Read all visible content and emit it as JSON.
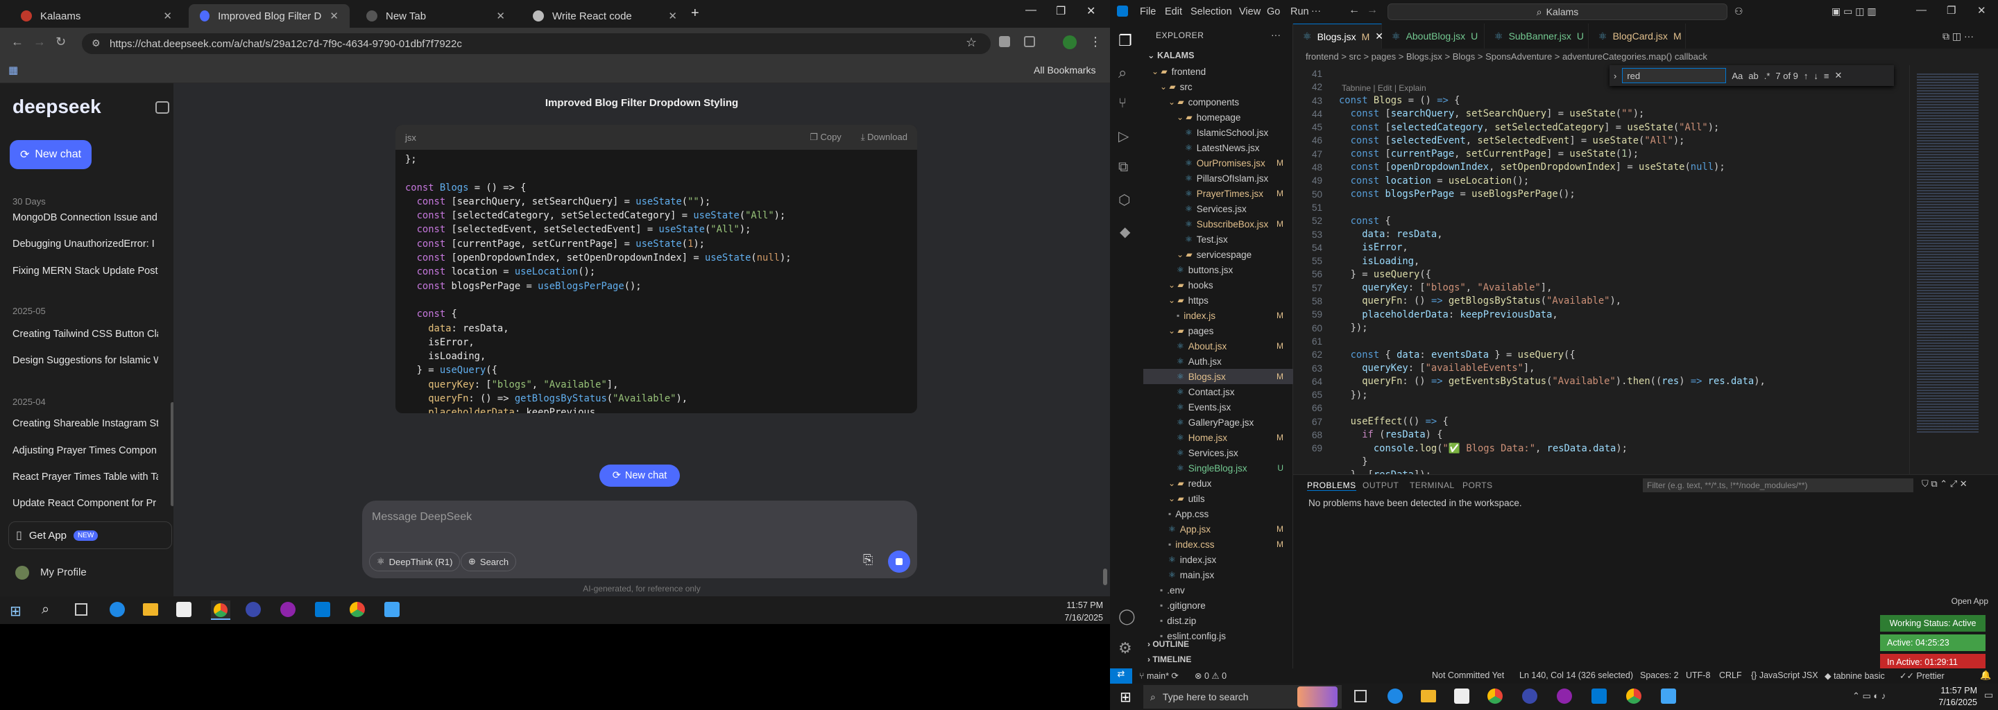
{
  "chrome": {
    "tabs": [
      {
        "label": "Kalaams"
      },
      {
        "label": "Improved Blog Filter Dropdown"
      },
      {
        "label": "New Tab"
      },
      {
        "label": "Write React code"
      }
    ],
    "url": "https://chat.deepseek.com/a/chat/s/29a12c7d-7f9c-4634-9790-01dbf7f7922c",
    "all_bookmarks": "All Bookmarks"
  },
  "deepseek": {
    "logo": "deepseek",
    "new_chat": "New chat",
    "history": [
      {
        "section": "30 Days",
        "items": [
          "MongoDB Connection Issue and",
          "Debugging UnauthorizedError: I",
          "Fixing MERN Stack Update Post I"
        ]
      },
      {
        "section": "2025-05",
        "items": [
          "Creating Tailwind CSS Button Cla",
          "Design Suggestions for Islamic W"
        ]
      },
      {
        "section": "2025-04",
        "items": [
          "Creating Shareable Instagram St",
          "Adjusting Prayer Times Compon",
          "React Prayer Times Table with Ta",
          "Update React Component for Pr"
        ]
      }
    ],
    "get_app": "Get App",
    "new_badge": "NEW",
    "profile": "My Profile",
    "chat_title": "Improved Blog Filter Dropdown Styling",
    "code_lang": "jsx",
    "copy": "Copy",
    "download": "Download",
    "new_chat_btn": "New chat",
    "input_placeholder": "Message DeepSeek",
    "deepthink": "DeepThink (R1)",
    "search": "Search",
    "disclaimer": "AI-generated, for reference only"
  },
  "taskbar_left": {
    "time": "11:57 PM",
    "date": "7/16/2025"
  },
  "vscode": {
    "menu": [
      "File",
      "Edit",
      "Selection",
      "View",
      "Go",
      "Run"
    ],
    "search": "Kalams",
    "explorer": "EXPLORER",
    "root": "KALAMS",
    "tabs": [
      {
        "label": "Blogs.jsx",
        "badge": "M"
      },
      {
        "label": "AboutBlog.jsx",
        "badge": "U"
      },
      {
        "label": "SubBanner.jsx",
        "badge": "U"
      },
      {
        "label": "BlogCard.jsx",
        "badge": "M"
      }
    ],
    "breadcrumb": "frontend > src > pages > Blogs.jsx > Blogs > SponsAdventure > adventureCategories.map() callback",
    "find": {
      "value": "red",
      "count": "7 of 9"
    },
    "tabnine": "Tabnine | Edit | Explain",
    "tree": [
      {
        "name": "frontend",
        "depth": 1,
        "type": "folder",
        "badge": ""
      },
      {
        "name": "src",
        "depth": 2,
        "type": "folder",
        "badge": ""
      },
      {
        "name": "components",
        "depth": 3,
        "type": "folder",
        "badge": ""
      },
      {
        "name": "homepage",
        "depth": 4,
        "type": "folder",
        "badge": ""
      },
      {
        "name": "IslamicSchool.jsx",
        "depth": 5,
        "type": "file",
        "badge": ""
      },
      {
        "name": "LatestNews.jsx",
        "depth": 5,
        "type": "file",
        "badge": ""
      },
      {
        "name": "OurPromises.jsx",
        "depth": 5,
        "type": "file",
        "badge": "M"
      },
      {
        "name": "PillarsOfIslam.jsx",
        "depth": 5,
        "type": "file",
        "badge": ""
      },
      {
        "name": "PrayerTimes.jsx",
        "depth": 5,
        "type": "file",
        "badge": "M"
      },
      {
        "name": "Services.jsx",
        "depth": 5,
        "type": "file",
        "badge": ""
      },
      {
        "name": "SubscribeBox.jsx",
        "depth": 5,
        "type": "file",
        "badge": "M"
      },
      {
        "name": "Test.jsx",
        "depth": 5,
        "type": "file",
        "badge": ""
      },
      {
        "name": "servicespage",
        "depth": 4,
        "type": "folder",
        "badge": ""
      },
      {
        "name": "buttons.jsx",
        "depth": 4,
        "type": "file",
        "badge": ""
      },
      {
        "name": "hooks",
        "depth": 3,
        "type": "folder",
        "badge": ""
      },
      {
        "name": "https",
        "depth": 3,
        "type": "folder",
        "badge": ""
      },
      {
        "name": "index.js",
        "depth": 4,
        "type": "file",
        "badge": "M"
      },
      {
        "name": "pages",
        "depth": 3,
        "type": "folder",
        "badge": ""
      },
      {
        "name": "About.jsx",
        "depth": 4,
        "type": "file",
        "badge": "M"
      },
      {
        "name": "Auth.jsx",
        "depth": 4,
        "type": "file",
        "badge": ""
      },
      {
        "name": "Blogs.jsx",
        "depth": 4,
        "type": "file",
        "badge": "M"
      },
      {
        "name": "Contact.jsx",
        "depth": 4,
        "type": "file",
        "badge": ""
      },
      {
        "name": "Events.jsx",
        "depth": 4,
        "type": "file",
        "badge": ""
      },
      {
        "name": "GalleryPage.jsx",
        "depth": 4,
        "type": "file",
        "badge": ""
      },
      {
        "name": "Home.jsx",
        "depth": 4,
        "type": "file",
        "badge": "M"
      },
      {
        "name": "Services.jsx",
        "depth": 4,
        "type": "file",
        "badge": ""
      },
      {
        "name": "SingleBlog.jsx",
        "depth": 4,
        "type": "file",
        "badge": "U"
      },
      {
        "name": "redux",
        "depth": 3,
        "type": "folder",
        "badge": ""
      },
      {
        "name": "utils",
        "depth": 3,
        "type": "folder",
        "badge": ""
      },
      {
        "name": "App.css",
        "depth": 3,
        "type": "file",
        "badge": ""
      },
      {
        "name": "App.jsx",
        "depth": 3,
        "type": "file",
        "badge": "M"
      },
      {
        "name": "index.css",
        "depth": 3,
        "type": "file",
        "badge": "M"
      },
      {
        "name": "index.jsx",
        "depth": 3,
        "type": "file",
        "badge": ""
      },
      {
        "name": "main.jsx",
        "depth": 3,
        "type": "file",
        "badge": ""
      },
      {
        "name": ".env",
        "depth": 2,
        "type": "file",
        "badge": ""
      },
      {
        "name": ".gitignore",
        "depth": 2,
        "type": "file",
        "badge": ""
      },
      {
        "name": "dist.zip",
        "depth": 2,
        "type": "file",
        "badge": ""
      },
      {
        "name": "eslint.config.js",
        "depth": 2,
        "type": "file",
        "badge": ""
      }
    ],
    "outline": "OUTLINE",
    "timeline": "TIMELINE",
    "line_numbers": [
      "41",
      "42",
      "43",
      "44",
      "45",
      "46",
      "47",
      "48",
      "49",
      "50",
      "51",
      "52",
      "53",
      "54",
      "55",
      "56",
      "57",
      "58",
      "59",
      "60",
      "61",
      "62",
      "63",
      "64",
      "65",
      "66",
      "67",
      "68",
      "69"
    ],
    "panel": {
      "tabs": [
        "PROBLEMS",
        "OUTPUT",
        "TERMINAL",
        "PORTS"
      ],
      "filter": "Filter (e.g. text, **/*.ts, !**/node_modules/**)",
      "message": "No problems have been detected in the workspace."
    },
    "status": {
      "branch": "main*",
      "errors": "0",
      "warnings": "0",
      "commit": "Not Committed Yet",
      "position": "Ln 140, Col 14 (326 selected)",
      "spaces": "Spaces: 2",
      "encoding": "UTF-8",
      "eol": "CRLF",
      "lang": "JavaScript JSX",
      "tabnine": "tabnine basic",
      "prettier": "Prettier"
    },
    "widgets": {
      "open_app": "Open App",
      "working": "Working Status: Active",
      "active": "Active: 04:25:23",
      "inactive": "In Active: 01:29:11"
    }
  },
  "windows_taskbar": {
    "search": "Type here to search",
    "time": "11:57 PM",
    "date": "7/16/2025"
  }
}
